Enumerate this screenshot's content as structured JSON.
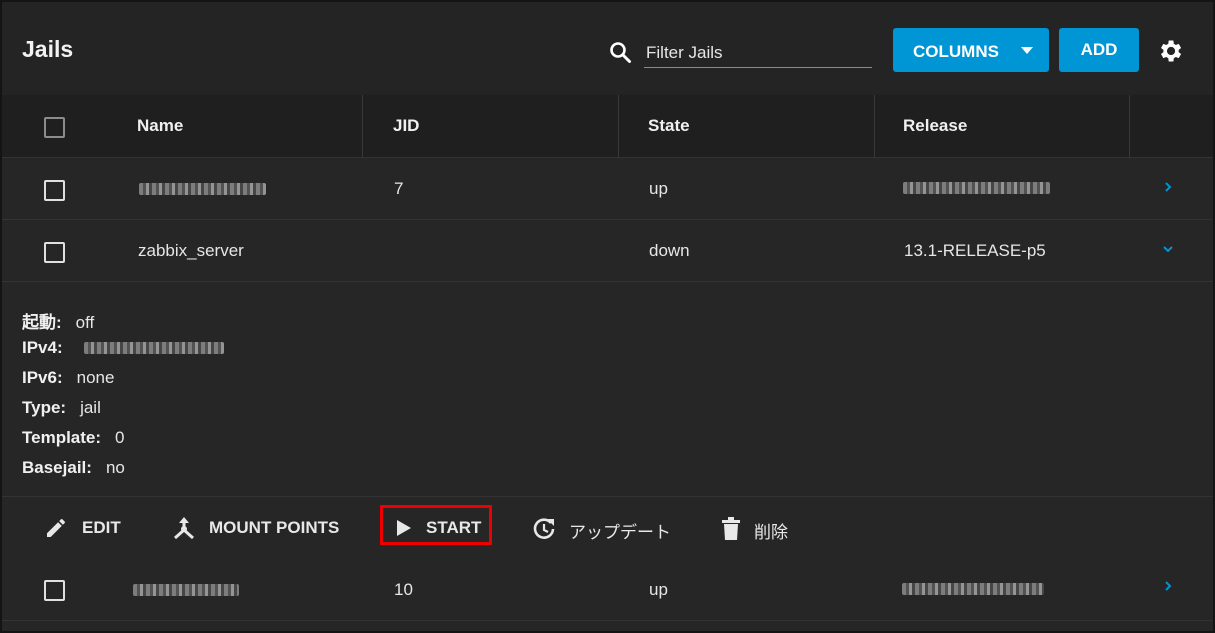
{
  "toolbar": {
    "title": "Jails",
    "search_placeholder": "Filter Jails",
    "columns_label": "COLUMNS",
    "add_label": "ADD"
  },
  "table": {
    "headers": [
      "Name",
      "JID",
      "State",
      "Release"
    ],
    "rows": [
      {
        "name": "",
        "jid": "7",
        "state": "up",
        "release": "",
        "expanded": false
      },
      {
        "name": "zabbix_server",
        "jid": "",
        "state": "down",
        "release": "13.1-RELEASE-p5",
        "expanded": true
      },
      {
        "name": "",
        "jid": "10",
        "state": "up",
        "release": "",
        "expanded": false
      }
    ]
  },
  "details": [
    {
      "label": "起動:",
      "value": "off"
    },
    {
      "label": "IPv4:",
      "value": ""
    },
    {
      "label": "IPv6:",
      "value": "none"
    },
    {
      "label": "Type:",
      "value": "jail"
    },
    {
      "label": "Template:",
      "value": "0"
    },
    {
      "label": "Basejail:",
      "value": "no"
    }
  ],
  "actions": {
    "edit": "EDIT",
    "mount_points": "MOUNT POINTS",
    "start": "START",
    "update": "アップデート",
    "delete": "削除"
  },
  "colors": {
    "accent": "#0095d5",
    "highlight": "#ee0000",
    "background": "#262626"
  }
}
